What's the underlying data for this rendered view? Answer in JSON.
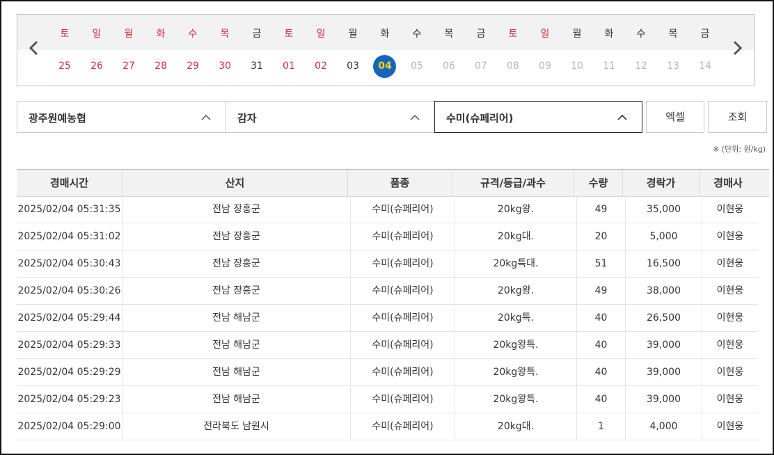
{
  "calendar": {
    "weekdays": [
      {
        "label": "토",
        "tone": "red"
      },
      {
        "label": "일",
        "tone": "red"
      },
      {
        "label": "월",
        "tone": "red"
      },
      {
        "label": "화",
        "tone": "red"
      },
      {
        "label": "수",
        "tone": "red"
      },
      {
        "label": "목",
        "tone": "red"
      },
      {
        "label": "금",
        "tone": "dark"
      },
      {
        "label": "토",
        "tone": "red"
      },
      {
        "label": "일",
        "tone": "red"
      },
      {
        "label": "월",
        "tone": "dark"
      },
      {
        "label": "화",
        "tone": "dark"
      },
      {
        "label": "수",
        "tone": "dark"
      },
      {
        "label": "목",
        "tone": "dark"
      },
      {
        "label": "금",
        "tone": "dark"
      },
      {
        "label": "토",
        "tone": "red"
      },
      {
        "label": "일",
        "tone": "red"
      },
      {
        "label": "월",
        "tone": "dark"
      },
      {
        "label": "화",
        "tone": "dark"
      },
      {
        "label": "수",
        "tone": "dark"
      },
      {
        "label": "목",
        "tone": "dark"
      },
      {
        "label": "금",
        "tone": "dark"
      }
    ],
    "days": [
      {
        "label": "25",
        "tone": "red"
      },
      {
        "label": "26",
        "tone": "red"
      },
      {
        "label": "27",
        "tone": "red"
      },
      {
        "label": "28",
        "tone": "red"
      },
      {
        "label": "29",
        "tone": "red"
      },
      {
        "label": "30",
        "tone": "red"
      },
      {
        "label": "31",
        "tone": "dark"
      },
      {
        "label": "01",
        "tone": "red"
      },
      {
        "label": "02",
        "tone": "red"
      },
      {
        "label": "03",
        "tone": "dark"
      },
      {
        "label": "04",
        "tone": "selected"
      },
      {
        "label": "05",
        "tone": "gray"
      },
      {
        "label": "06",
        "tone": "gray"
      },
      {
        "label": "07",
        "tone": "gray"
      },
      {
        "label": "08",
        "tone": "gray"
      },
      {
        "label": "09",
        "tone": "gray"
      },
      {
        "label": "10",
        "tone": "gray"
      },
      {
        "label": "11",
        "tone": "gray"
      },
      {
        "label": "12",
        "tone": "gray"
      },
      {
        "label": "13",
        "tone": "gray"
      },
      {
        "label": "14",
        "tone": "gray"
      }
    ],
    "prev_icon": "chevron-left-icon",
    "next_icon": "chevron-right-icon"
  },
  "filters": {
    "market": "광주원예농협",
    "item": "감자",
    "variety": "수미(슈페리어)",
    "excel_label": "엑셀",
    "search_label": "조회",
    "unit_note": "※ (단위: 원/kg)"
  },
  "table": {
    "headers": [
      "경매시간",
      "산지",
      "품종",
      "규격/등급/과수",
      "수량",
      "경락가",
      "경매사"
    ],
    "rows": [
      [
        "2025/02/04 05:31:35",
        "전남 장흥군",
        "수미(슈페리어)",
        "20kg왕.",
        "49",
        "35,000",
        "이현웅"
      ],
      [
        "2025/02/04 05:31:02",
        "전남 장흥군",
        "수미(슈페리어)",
        "20kg대.",
        "20",
        "5,000",
        "이현웅"
      ],
      [
        "2025/02/04 05:30:43",
        "전남 장흥군",
        "수미(슈페리어)",
        "20kg특대.",
        "51",
        "16,500",
        "이현웅"
      ],
      [
        "2025/02/04 05:30:26",
        "전남 장흥군",
        "수미(슈페리어)",
        "20kg왕.",
        "49",
        "38,000",
        "이현웅"
      ],
      [
        "2025/02/04 05:29:44",
        "전남 해남군",
        "수미(슈페리어)",
        "20kg특.",
        "40",
        "26,500",
        "이현웅"
      ],
      [
        "2025/02/04 05:29:33",
        "전남 해남군",
        "수미(슈페리어)",
        "20kg왕특.",
        "40",
        "39,000",
        "이현웅"
      ],
      [
        "2025/02/04 05:29:29",
        "전남 해남군",
        "수미(슈페리어)",
        "20kg왕특.",
        "40",
        "39,000",
        "이현웅"
      ],
      [
        "2025/02/04 05:29:23",
        "전남 해남군",
        "수미(슈페리어)",
        "20kg왕특.",
        "40",
        "39,000",
        "이현웅"
      ],
      [
        "2025/02/04 05:29:00",
        "전라북도 남원시",
        "수미(슈페리어)",
        "20kg대.",
        "1",
        "4,000",
        "이현웅"
      ]
    ]
  },
  "colors": {
    "weekend_red": "#d32f2f",
    "selected_day_bg": "#1565c0",
    "selected_day_text": "#ffd400",
    "inactive_gray": "#b5b5b5"
  }
}
